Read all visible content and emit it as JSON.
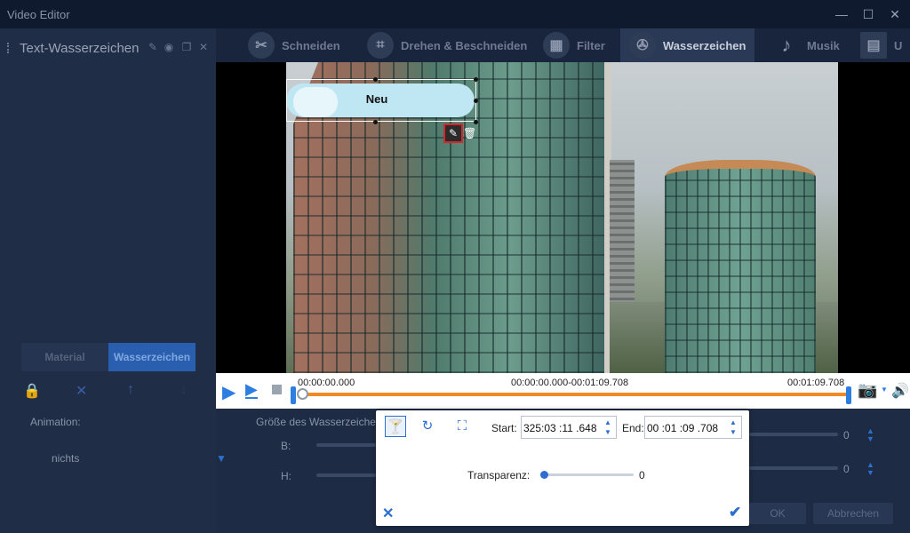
{
  "window": {
    "title": "Video Editor",
    "min": "—",
    "max": "☐",
    "close": "✕"
  },
  "left_panel": {
    "title": "Text-Wasserzeichen",
    "tabs": [
      "Material",
      "Wasserzeichen"
    ],
    "animation_label": "Animation:",
    "animation_value": "nichts",
    "size_label": "Größe des Wasserzeichens",
    "width_label": "B:",
    "height_label": "H:",
    "size_b_value": "0",
    "size_h_value": "0"
  },
  "top_tabs": [
    {
      "label": "Schneiden",
      "icon": "scissors-icon"
    },
    {
      "label": "Drehen & Beschneiden",
      "icon": "crop-icon"
    },
    {
      "label": "Filter",
      "icon": "filter-icon"
    },
    {
      "label": "Wasserzeichen",
      "icon": "film-reel-icon",
      "active": true
    },
    {
      "label": "Musik",
      "icon": "music-note-icon"
    },
    {
      "label": "U",
      "icon": "subtitle-icon"
    }
  ],
  "watermark": {
    "text": "Neu"
  },
  "player": {
    "time_current": "00:00:00.000",
    "time_range": "00:00:00.000-00:01:09.708",
    "time_end": "00:01:09.708",
    "progress": 0
  },
  "dialog": {
    "start_label": "Start:",
    "start_value": "325:03 :11 .648",
    "end_label": "End:",
    "end_value": "00 :01 :09 .708",
    "transparency_label": "Transparenz:",
    "transparency_value": "0"
  },
  "footer": {
    "ok": "OK",
    "cancel": "Abbrechen"
  },
  "colors": {
    "accent": "#2c7ee0",
    "progress": "#f08a24",
    "background": "#1d2b44"
  }
}
